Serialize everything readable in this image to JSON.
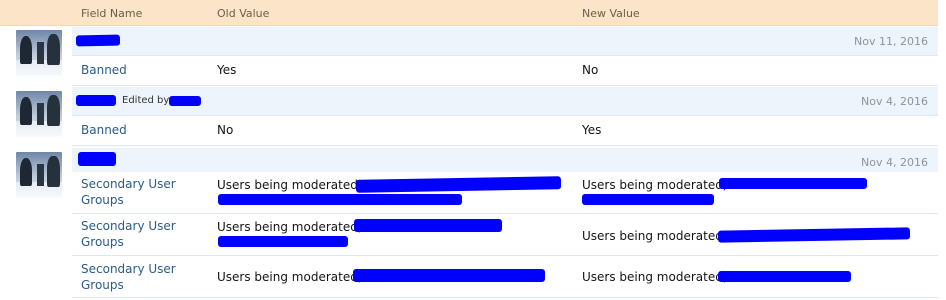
{
  "header": {
    "field_name": "Field Name",
    "old_value": "Old Value",
    "new_value": "New Value"
  },
  "entries": [
    {
      "date": "Nov 11, 2016",
      "rows": [
        {
          "field": "Banned",
          "old": "Yes",
          "new": "No"
        }
      ]
    },
    {
      "date": "Nov 4, 2016",
      "edited_by": "Edited by",
      "rows": [
        {
          "field": "Banned",
          "old": "No",
          "new": "Yes"
        }
      ]
    },
    {
      "date": "Nov 4, 2016",
      "rows": [
        {
          "field": "Secondary User",
          "field2": "Groups",
          "old": "Users being moderated,",
          "new": "Users being moderated,"
        },
        {
          "field": "Secondary User",
          "field2": "Groups",
          "old": "Users being moderated,",
          "new": "Users being moderated,"
        },
        {
          "field": "Secondary User",
          "field2": "Groups",
          "old": "Users being moderated,",
          "new": "Users being moderated,"
        }
      ]
    }
  ],
  "colors": {
    "header_bg": "#fbe4c8",
    "group_bg": "#eef4fb",
    "field_link": "#2b5b86",
    "redaction": "#0000ff"
  }
}
